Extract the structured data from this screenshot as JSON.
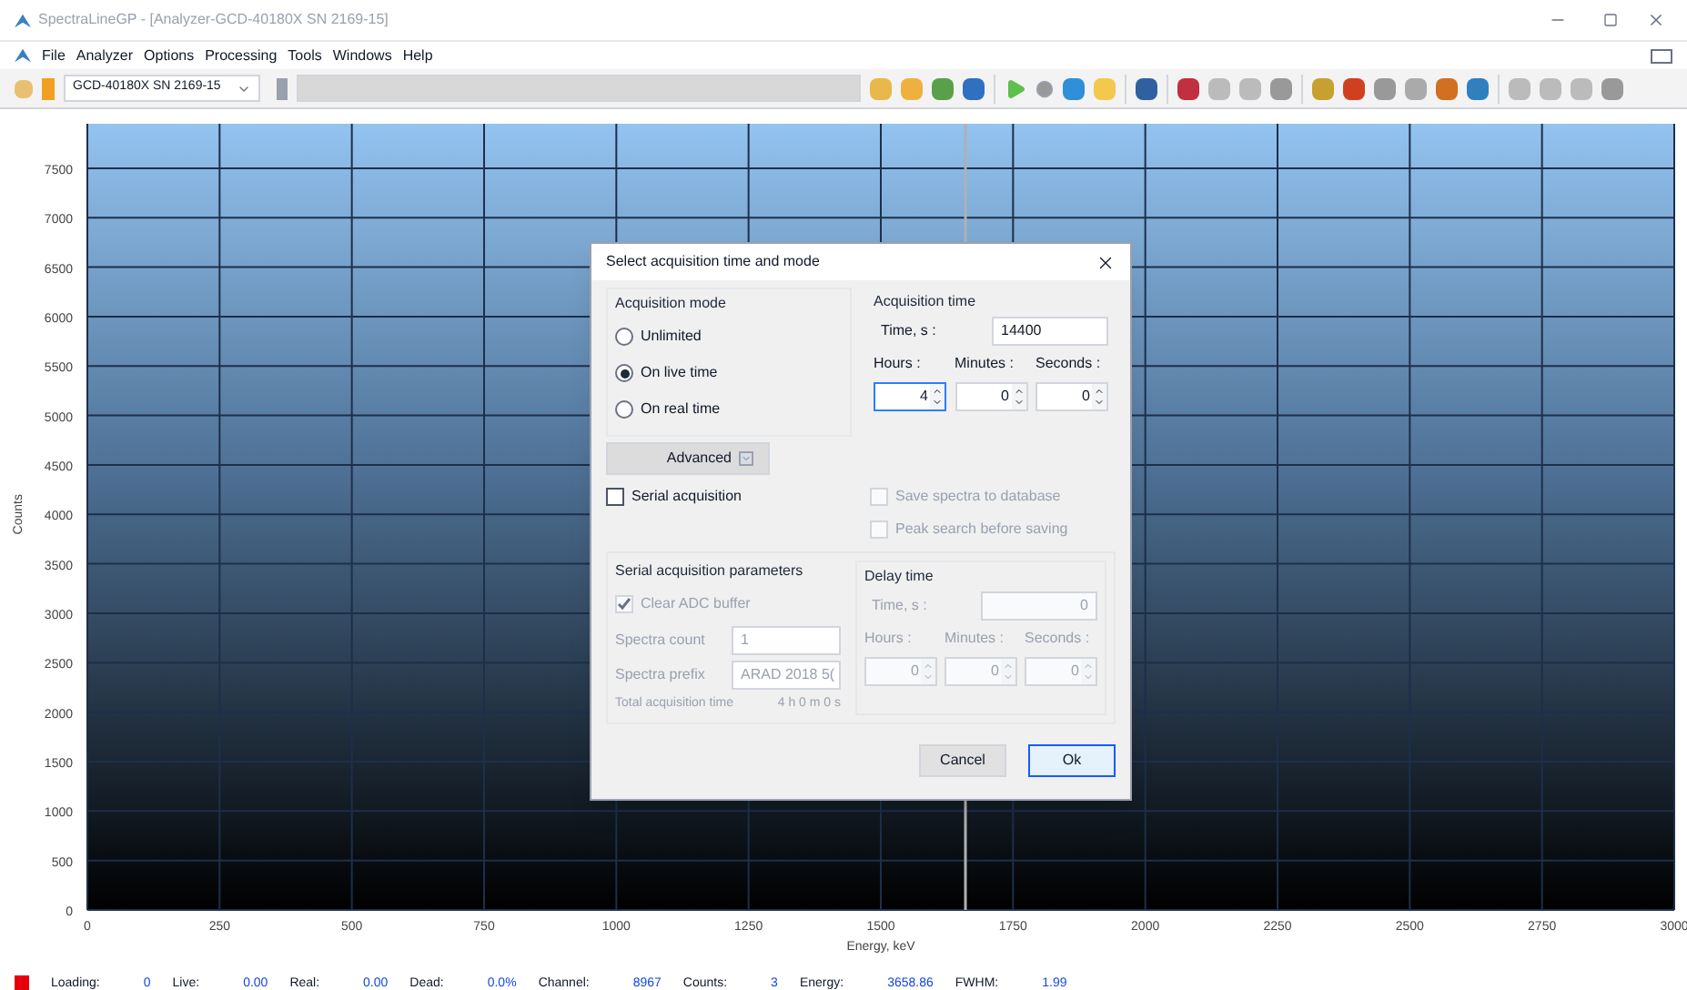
{
  "window": {
    "title": "SpectraLineGP - [Analyzer-GCD-40180X SN 2169-15]"
  },
  "menu": [
    "File",
    "Analyzer",
    "Options",
    "Processing",
    "Tools",
    "Windows",
    "Help"
  ],
  "toolbar": {
    "device": "GCD-40180X SN 2169-15"
  },
  "plot": {
    "chart_data": {
      "type": "line",
      "xlabel": "Energy, keV",
      "ylabel": "Counts",
      "xlim": [
        0,
        3000
      ],
      "ylim": [
        0,
        7950
      ],
      "xticks": [
        0,
        250,
        500,
        750,
        1000,
        1250,
        1500,
        1750,
        2000,
        2250,
        2500,
        2750,
        3000
      ],
      "yticks": [
        0,
        500,
        1000,
        1500,
        2000,
        2500,
        3000,
        3500,
        4000,
        4500,
        5000,
        5500,
        6000,
        6500,
        7000,
        7500
      ],
      "grid": true,
      "ref_lines": [
        {
          "axis": "x",
          "value": 1660
        }
      ]
    }
  },
  "dialog": {
    "title": "Select acquisition time and mode",
    "mode_group": {
      "title": "Acquisition mode",
      "options": [
        {
          "label": "Unlimited",
          "selected": false
        },
        {
          "label": "On live time",
          "selected": true
        },
        {
          "label": "On real time",
          "selected": false
        }
      ]
    },
    "time_group": {
      "title": "Acquisition time",
      "time_label": "Time, s :",
      "time_value": "14400",
      "units": [
        {
          "label": "Hours :",
          "value": "4"
        },
        {
          "label": "Minutes :",
          "value": "0"
        },
        {
          "label": "Seconds :",
          "value": "0"
        }
      ]
    },
    "advanced_button": "Advanced",
    "checks": [
      {
        "label": "Serial acquisition",
        "checked": false,
        "disabled": false
      },
      {
        "label": "Save spectra to database",
        "checked": false,
        "disabled": true
      },
      {
        "label": "Peak search before saving",
        "checked": false,
        "disabled": true
      }
    ],
    "serial_group": {
      "title": "Serial acquisition parameters",
      "clear_adc": {
        "label": "Clear ADC buffer",
        "checked": true,
        "disabled": true
      },
      "fields": [
        {
          "label": "Spectra count",
          "value": "1"
        },
        {
          "label": "Spectra prefix",
          "value": "ARAD 2018 5("
        }
      ],
      "total_label": "Total acquisition time",
      "total_value": "4 h 0 m 0 s"
    },
    "delay_group": {
      "title": "Delay time",
      "time_label": "Time, s :",
      "time_value": "0",
      "units": [
        {
          "label": "Hours :",
          "value": "0"
        },
        {
          "label": "Minutes :",
          "value": "0"
        },
        {
          "label": "Seconds :",
          "value": "0"
        }
      ]
    },
    "buttons": [
      "Cancel",
      "Ok"
    ]
  },
  "status_bar": [
    {
      "label": "Loading:",
      "value": "0"
    },
    {
      "label": "Live:",
      "value": "0.00"
    },
    {
      "label": "Real:",
      "value": "0.00"
    },
    {
      "label": "Dead:",
      "value": "0.0%"
    },
    {
      "label": "Channel:",
      "value": "8967"
    },
    {
      "label": "Counts:",
      "value": "3"
    },
    {
      "label": "Energy:",
      "value": "3658.86"
    },
    {
      "label": "FWHM:",
      "value": "1.99"
    }
  ]
}
